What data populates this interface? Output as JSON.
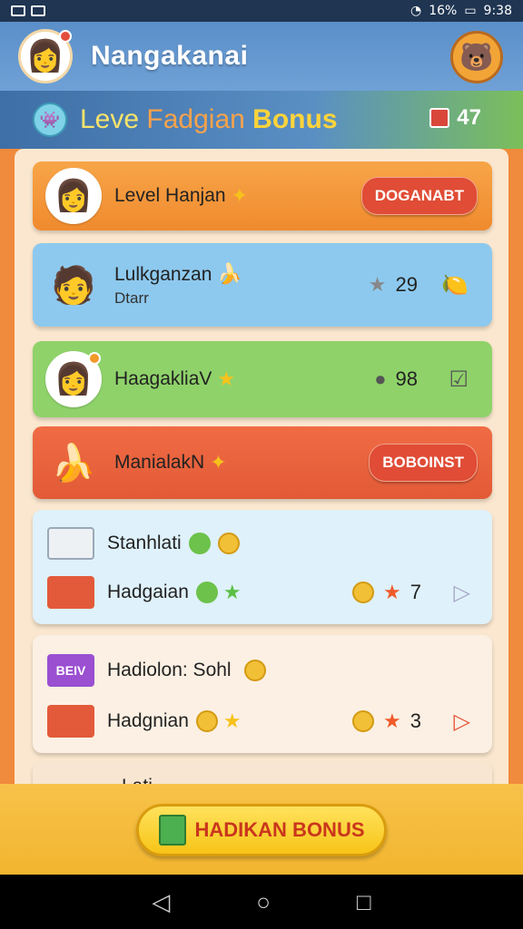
{
  "status": {
    "battery": "16%",
    "time": "9:38"
  },
  "header": {
    "title": "Nangakanai"
  },
  "banner": {
    "word1": "Leve",
    "word2": "Fadgian",
    "word3": "Bonus",
    "count": "47"
  },
  "cards": {
    "c1": {
      "label": "Level Hanjan",
      "button": "DOGANABT"
    },
    "c2": {
      "label": "Lulkganzan",
      "sub": "Dtarr",
      "count": "29"
    },
    "c3": {
      "label": "HaagakliaV",
      "count": "98"
    },
    "c4": {
      "label": "ManialakN",
      "button": "BOBOINST"
    },
    "c5": {
      "row1": "Stanhlati",
      "row2": "Hadgaian",
      "count": "7"
    },
    "c6": {
      "row1": "Hadiolon: Sohl",
      "row2": "Hadgnian",
      "count": "3",
      "badge": "BEIV"
    },
    "c7": {
      "label": "Lati"
    }
  },
  "footer": {
    "cta": "HADIKAN BONUS"
  },
  "colors": {
    "accent": "#f08a2e",
    "header": "#5b8fc9",
    "cta": "#f7c417"
  }
}
